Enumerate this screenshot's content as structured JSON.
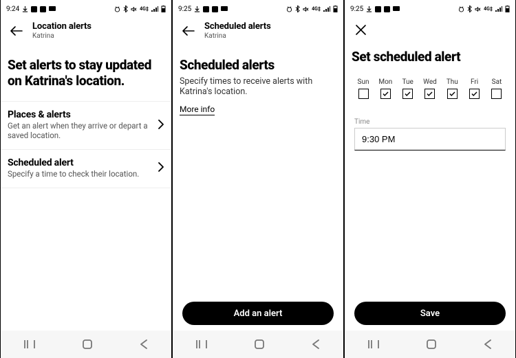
{
  "status": {
    "time_a": "9:24",
    "time_b": "9:25",
    "time_c": "9:25"
  },
  "screen1": {
    "header_title": "Location alerts",
    "header_sub": "Katrina",
    "headline": "Set alerts to stay updated on Katrina's location.",
    "row1_title": "Places & alerts",
    "row1_sub": "Get an alert when they arrive or depart a saved location.",
    "row2_title": "Scheduled alert",
    "row2_sub": "Specify a time to check their location."
  },
  "screen2": {
    "header_title": "Scheduled alerts",
    "header_sub": "Katrina",
    "headline": "Scheduled alerts",
    "subtext": "Specify times to receive alerts with Katrina's location.",
    "more": "More info",
    "button": "Add an alert"
  },
  "screen3": {
    "headline": "Set scheduled alert",
    "days": [
      "Sun",
      "Mon",
      "Tue",
      "Wed",
      "Thu",
      "Fri",
      "Sat"
    ],
    "checked": [
      false,
      true,
      true,
      true,
      true,
      true,
      false
    ],
    "time_label": "Time",
    "time_value": "9:30 PM",
    "button": "Save"
  }
}
